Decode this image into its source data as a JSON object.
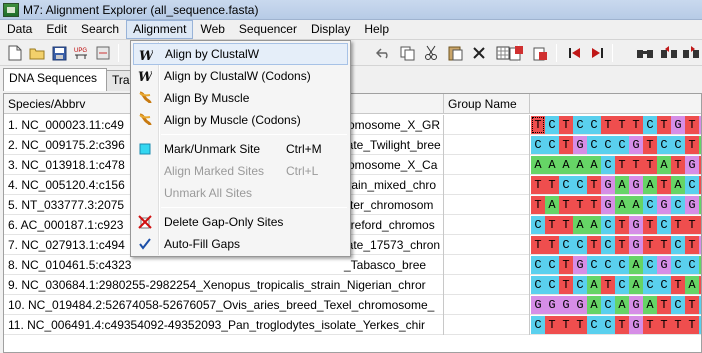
{
  "window": {
    "title": "M7: Alignment Explorer (all_sequence.fasta)"
  },
  "menubar": {
    "items": [
      "Data",
      "Edit",
      "Search",
      "Alignment",
      "Web",
      "Sequencer",
      "Display",
      "Help"
    ],
    "active": "Alignment"
  },
  "tabs": [
    {
      "label": "DNA Sequences",
      "active": true
    },
    {
      "label": "Tra",
      "active": false
    }
  ],
  "table": {
    "headers": {
      "species": "Species/Abbrv",
      "group": "Group Name"
    },
    "rows": [
      {
        "name": "1. NC_000023.11:c49",
        "name_tail": "romosome_X_GR",
        "seq": "TCTCCTTTCTGTG"
      },
      {
        "name": "2. NC_009175.2:c396",
        "name_tail": "late_Twilight_bree",
        "seq": "CCTGCCCGTCCTA"
      },
      {
        "name": "3. NC_013918.1:c478",
        "name_tail": "romosome_X_Ca",
        "seq": "AAAAACTTTATGT"
      },
      {
        "name": "4. NC_005120.4:c156",
        "name_tail": "train_mixed_chro",
        "seq": "TTCCTGAGATACT"
      },
      {
        "name": "5. NT_033777.3:2075",
        "name_tail": "ster_chromosom",
        "seq": "TATTTGAACGCGA"
      },
      {
        "name": "6. AC_000187.1:c923",
        "name_tail": "ereford_chromos",
        "seq": "CTTAACTGTCTTT"
      },
      {
        "name": "7. NC_027913.1:c494",
        "name_tail": "late_17573_chron",
        "seq": "TTCCTCTGTTCTG"
      },
      {
        "name": "8. NC_010461.5:c4323",
        "name_tail": "_Tabasco_bree",
        "seq": "CCTGCCCACGCCA"
      },
      {
        "name": "9. NC_030684.1:2980255-2982254_Xenopus_tropicalis_strain_Nigerian_chror",
        "name_tail": "",
        "seq": "CCTCATCACCTAT"
      },
      {
        "name": "10. NC_019484.2:52674058-52676057_Ovis_aries_breed_Texel_chromosome_",
        "name_tail": "",
        "seq": "GGGGACAGATCTC"
      },
      {
        "name": "11. NC_006491.4:c49354092-49352093_Pan_troglodytes_isolate_Yerkes_chir",
        "name_tail": "",
        "seq": "CTTTCCTGTTTTC"
      }
    ]
  },
  "alignment_menu": {
    "items": [
      {
        "label": "Align by ClustalW",
        "icon": "clustalw-icon",
        "shortcut": "",
        "disabled": false,
        "highlighted": true
      },
      {
        "label": "Align by ClustalW (Codons)",
        "icon": "clustalw-codons-icon",
        "shortcut": "",
        "disabled": false,
        "highlighted": false
      },
      {
        "label": "Align By Muscle",
        "icon": "muscle-icon",
        "shortcut": "",
        "disabled": false,
        "highlighted": false
      },
      {
        "label": "Align by Muscle (Codons)",
        "icon": "muscle-codons-icon",
        "shortcut": "",
        "disabled": false,
        "highlighted": false
      },
      {
        "label": "Mark/Unmark Site",
        "icon": "mark-site-icon",
        "shortcut": "Ctrl+M",
        "disabled": false,
        "highlighted": false
      },
      {
        "label": "Align Marked Sites",
        "icon": "",
        "shortcut": "Ctrl+L",
        "disabled": true,
        "highlighted": false
      },
      {
        "label": "Unmark All Sites",
        "icon": "",
        "shortcut": "",
        "disabled": true,
        "highlighted": false
      },
      {
        "label": "Delete Gap-Only Sites",
        "icon": "delete-gap-icon",
        "shortcut": "",
        "disabled": false,
        "highlighted": false
      },
      {
        "label": "Auto-Fill Gaps",
        "icon": "checkmark-icon",
        "shortcut": "",
        "disabled": false,
        "highlighted": false
      }
    ]
  },
  "colors": {
    "A": "#66d466",
    "C": "#5ad0ee",
    "G": "#d68ee6",
    "T": "#ef4e4e",
    "highlight": "#e5eef9"
  }
}
